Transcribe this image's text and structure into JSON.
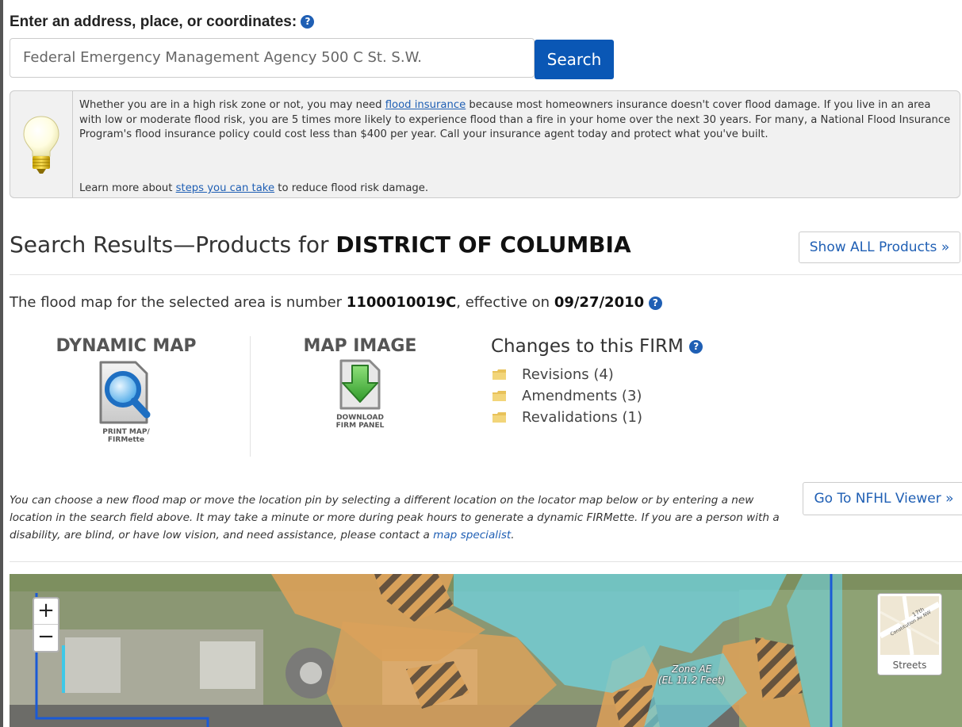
{
  "search": {
    "label": "Enter an address, place, or coordinates:",
    "placeholder": "Federal Emergency Management Agency 500 C St. S.W.",
    "button_label": "Search",
    "help_glyph": "?"
  },
  "tip": {
    "text_before_link": "Whether you are in a high risk zone or not, you may need ",
    "link_flood_insurance": "flood insurance",
    "text_after_link": " because most homeowners insurance doesn't cover flood damage. If you live in an area with low or moderate flood risk, you are 5 times more likely to experience flood than a fire in your home over the next 30 years. For many, a National Flood Insurance Program's flood insurance policy could cost less than $400 per year. Call your insurance agent today and protect what you've built.",
    "learn_before": "Learn more about ",
    "learn_link": "steps you can take",
    "learn_after": " to reduce flood risk damage.",
    "icon": "lightbulb-icon"
  },
  "results": {
    "title_prefix": "Search Results—Products for ",
    "title_place": "DISTRICT OF COLUMBIA",
    "show_all_label": "Show ALL Products »"
  },
  "flood_map": {
    "text_before": "The flood map for the selected area is number ",
    "number": "1100010019C",
    "text_mid": ", effective on ",
    "date": "09/27/2010"
  },
  "products": {
    "dynamic_map_title": "DYNAMIC MAP",
    "dynamic_map_caption_1": "PRINT MAP/",
    "dynamic_map_caption_2": "FIRMette",
    "map_image_title": "MAP IMAGE",
    "map_image_caption_1": "DOWNLOAD",
    "map_image_caption_2": "FIRM PANEL"
  },
  "changes": {
    "title": "Changes to this FIRM",
    "items": [
      {
        "label": "Revisions (4)"
      },
      {
        "label": "Amendments (3)"
      },
      {
        "label": "Revalidations (1)"
      }
    ]
  },
  "notice": {
    "text": "You can choose a new flood map or move the location pin by selecting a different location on the locator map below or by entering a new location in the search field above. It may take a minute or more during peak hours to generate a dynamic FIRMette. If you are a person with a disability, are blind, or have low vision, and need assistance, please contact a ",
    "link": "map specialist",
    "end": "."
  },
  "nfhl_button_label": "Go To NFHL Viewer »",
  "map": {
    "zoom_in": "+",
    "zoom_out": "−",
    "basemap_label": "Streets",
    "basemap_street_1": "Constitution Av NW",
    "basemap_street_2": "17th",
    "zone_label_1": "Zone AE",
    "zone_label_2": "(EL 11.2 Feet)"
  },
  "colors": {
    "accent_blue": "#0a57b5",
    "link_blue": "#1f5fb4",
    "zone_ae_fill": "#6fd3e0",
    "zone_x_fill": "#d9a15a",
    "boundary_blue": "#1a5ad6"
  }
}
